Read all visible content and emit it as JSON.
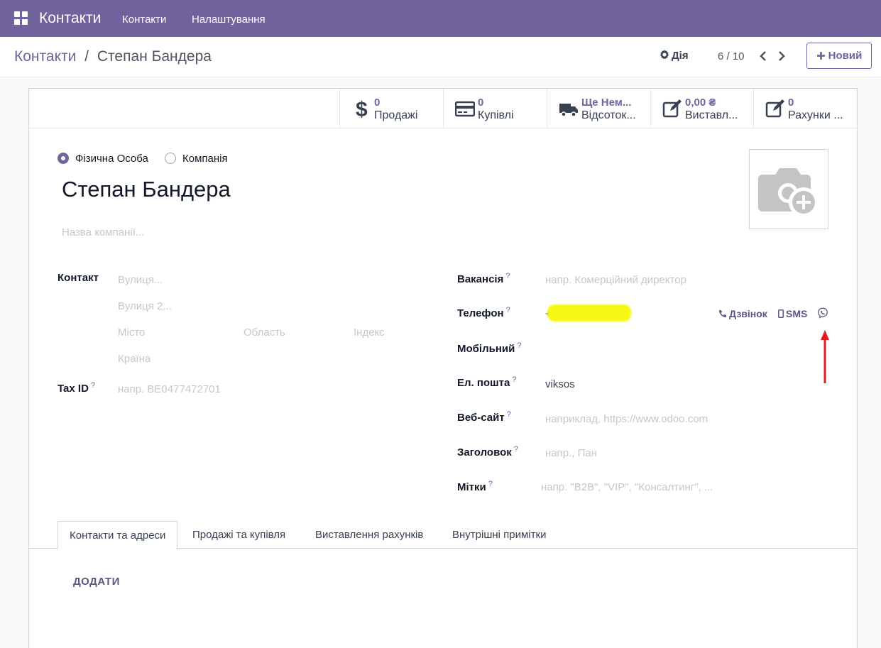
{
  "navbar": {
    "brand": "Контакти",
    "menu": [
      "Контакти",
      "Налаштування"
    ]
  },
  "control_panel": {
    "breadcrumb_parent": "Контакти",
    "breadcrumb_sep": "/",
    "breadcrumb_current": "Степан Бандера",
    "action_label": "Дія",
    "pager": "6 / 10",
    "new_label": "Новий"
  },
  "smart_buttons": [
    {
      "value": "0",
      "label": "Продажі",
      "icon": "dollar-icon"
    },
    {
      "value": "0",
      "label": "Купівлі",
      "icon": "credit-card-icon"
    },
    {
      "value": "Ще Нем...",
      "label": "Відсоток...",
      "icon": "truck-icon"
    },
    {
      "value": "0,00 ₴",
      "label": "Виставл...",
      "icon": "edit-icon"
    },
    {
      "value": "0",
      "label": "Рахунки ...",
      "icon": "edit-icon"
    }
  ],
  "form": {
    "type_person": "Фізична Особа",
    "type_company": "Компанія",
    "name": "Степан Бандера",
    "company_placeholder": "Назва компанії...",
    "contact_label": "Контакт",
    "street_placeholder": "Вулиця...",
    "street2_placeholder": "Вулиця 2...",
    "city_placeholder": "Місто",
    "state_placeholder": "Область",
    "zip_placeholder": "Індекс",
    "country_placeholder": "Країна",
    "taxid_label": "Tax ID",
    "taxid_placeholder": "напр. BE0477472701",
    "job_label": "Вакансія",
    "job_placeholder": "напр. Комерційний директор",
    "phone_label": "Телефон",
    "phone_value": "+",
    "call_label": "Дзвінок",
    "sms_label": "SMS",
    "mobile_label": "Мобільний",
    "email_label": "Ел. пошта",
    "email_value": "viksos",
    "website_label": "Веб-сайт",
    "website_placeholder": "наприклад, https://www.odoo.com",
    "title_label": "Заголовок",
    "title_placeholder": "напр., Пан",
    "tags_label": "Мітки",
    "tags_placeholder": "напр. \"B2B\", \"VIP\", \"Консалтинг\", ...",
    "help_mark": "?"
  },
  "tabs": [
    "Контакти та адреси",
    "Продажі та купівля",
    "Виставлення рахунків",
    "Внутрішні примітки"
  ],
  "add_label": "ДОДАТИ",
  "colors": {
    "brand": "#71639e",
    "highlight": "#f7f714",
    "arrow": "#e11d1d"
  }
}
